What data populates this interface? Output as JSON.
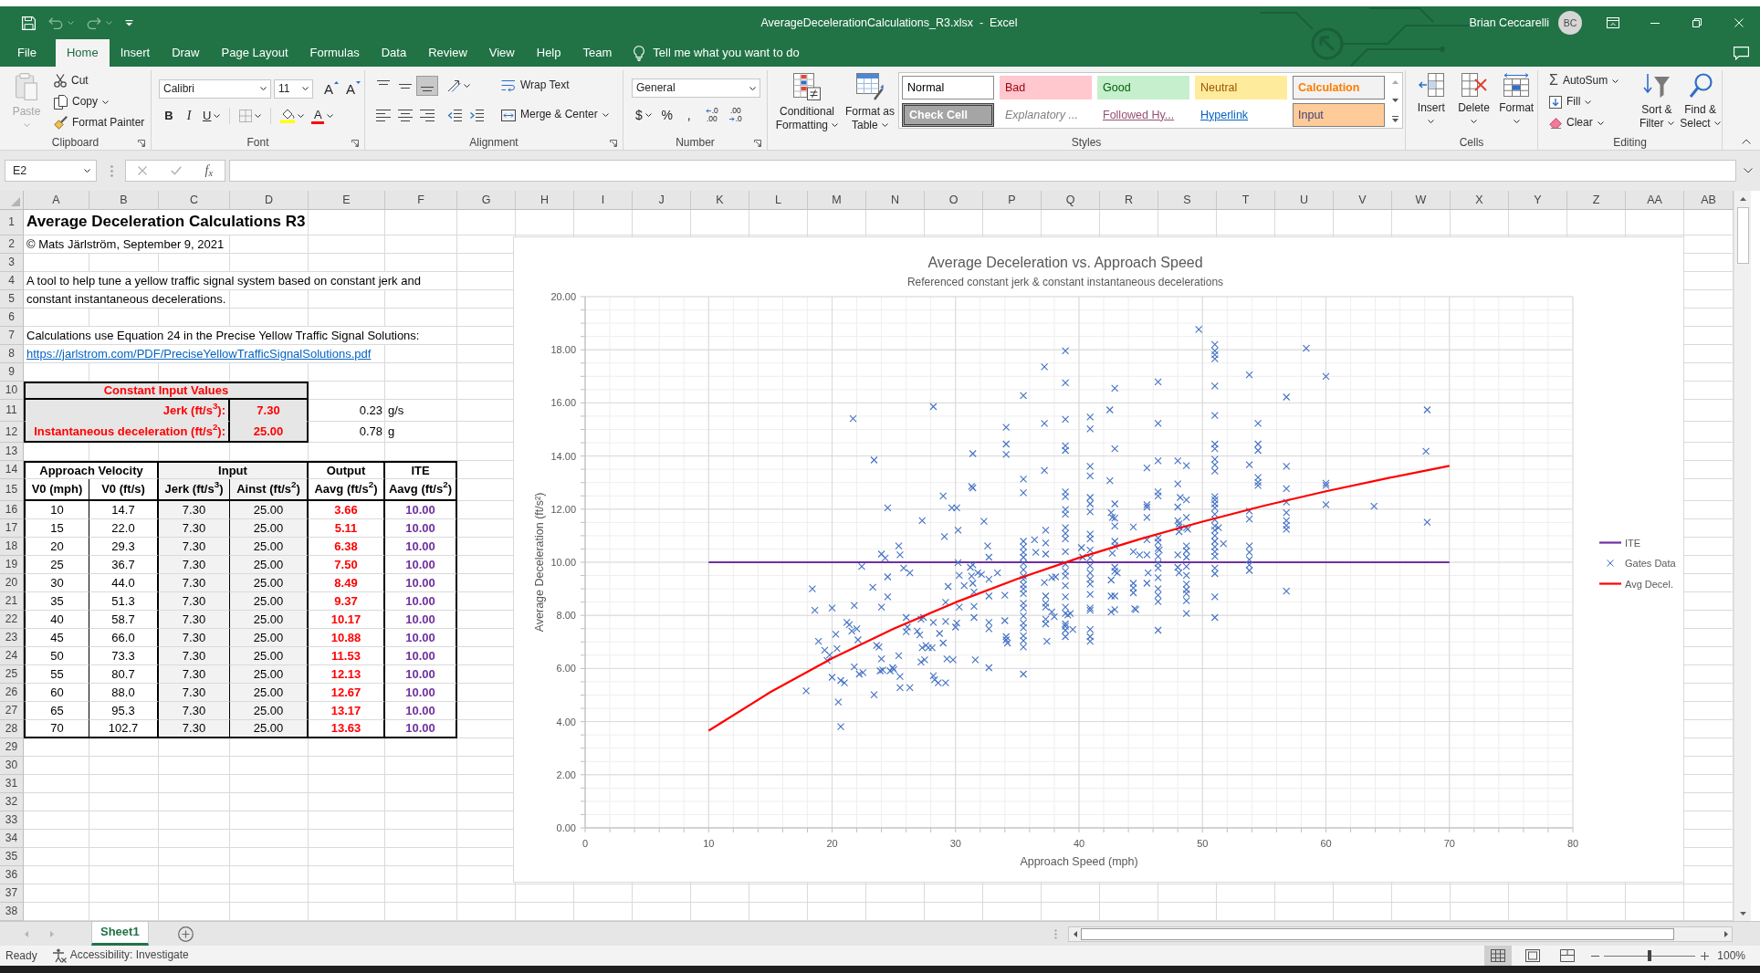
{
  "title_bar": {
    "quick_access": [
      {
        "kind": "save",
        "disabled": false
      },
      {
        "kind": "undo",
        "disabled": true
      },
      {
        "kind": "redo",
        "disabled": true
      },
      {
        "kind": "customize",
        "disabled": false
      }
    ],
    "title": "AverageDecelerationCalculations_R3.xlsx  -  Excel",
    "user": "Brian Ceccarelli",
    "avatar": "BC"
  },
  "tabs": [
    {
      "label": "File",
      "selected": false
    },
    {
      "label": "Home",
      "selected": true
    },
    {
      "label": "Insert",
      "selected": false
    },
    {
      "label": "Draw",
      "selected": false
    },
    {
      "label": "Page Layout",
      "selected": false
    },
    {
      "label": "Formulas",
      "selected": false
    },
    {
      "label": "Data",
      "selected": false
    },
    {
      "label": "Review",
      "selected": false
    },
    {
      "label": "View",
      "selected": false
    },
    {
      "label": "Help",
      "selected": false
    },
    {
      "label": "Team",
      "selected": false
    }
  ],
  "tell_me": {
    "label": "Tell me what you want to do"
  },
  "ribbon": {
    "clipboard": {
      "label": "Clipboard",
      "paste": {
        "label": "Paste",
        "disabled": true
      },
      "cut": "Cut",
      "copy": "Copy",
      "format_painter": "Format Painter"
    },
    "font": {
      "label": "Font",
      "font_name": "Calibri",
      "font_size": "11",
      "grow": "A",
      "shrink": "A",
      "bold": "B",
      "italic": "I",
      "underline": "U",
      "font_color": "A"
    },
    "alignment": {
      "label": "Alignment",
      "vertical": [
        {
          "kind": "top",
          "selected": false
        },
        {
          "kind": "middle",
          "selected": false
        },
        {
          "kind": "bottom",
          "selected": true
        }
      ],
      "horizontal": [
        {
          "kind": "left",
          "selected": false
        },
        {
          "kind": "center",
          "selected": false
        },
        {
          "kind": "right",
          "selected": false
        }
      ],
      "wrap_text": "Wrap Text",
      "merge": "Merge & Center"
    },
    "number": {
      "label": "Number",
      "format": "General",
      "currency": "$",
      "percent": "%",
      "comma": ",",
      "increase_decimal": {
        "upper": ".0",
        "lower": ".00"
      },
      "decrease_decimal": {
        "upper": ".00",
        "lower": ".0"
      }
    },
    "styles": {
      "label": "Styles",
      "conditional_formatting": "Conditional Formatting",
      "format_as_table": "Format as Table",
      "gallery": [
        {
          "label": "Normal",
          "kind": "normal"
        },
        {
          "label": "Bad",
          "kind": "bad"
        },
        {
          "label": "Good",
          "kind": "good"
        },
        {
          "label": "Neutral",
          "kind": "neutral"
        },
        {
          "label": "Calculation",
          "kind": "calculation"
        },
        {
          "label": "Check Cell",
          "kind": "check"
        },
        {
          "label": "Explanatory ...",
          "kind": "explanatory"
        },
        {
          "label": "Followed Hy...",
          "kind": "followed"
        },
        {
          "label": "Hyperlink",
          "kind": "hyperlink"
        },
        {
          "label": "Input",
          "kind": "input"
        }
      ]
    },
    "cells": {
      "label": "Cells",
      "insert": "Insert",
      "delete": "Delete",
      "format": "Format"
    },
    "editing": {
      "label": "Editing",
      "autosum_symbol": "Σ",
      "autosum": "AutoSum",
      "fill": "Fill",
      "clear": "Clear",
      "sort_filter": "Sort & Filter",
      "find_select": "Find & Select"
    }
  },
  "formula_bar": {
    "name_box": "E2",
    "insert_function": "f$_{x}$"
  },
  "sheet": {
    "columns": [
      "A",
      "B",
      "C",
      "D",
      "E",
      "F",
      "G",
      "H",
      "I",
      "J",
      "K",
      "L",
      "M",
      "N",
      "O",
      "P",
      "Q",
      "R",
      "S",
      "T",
      "U",
      "V",
      "W",
      "X",
      "Y",
      "Z",
      "AA",
      "AB"
    ],
    "rows": [
      "1",
      "2",
      "3",
      "4",
      "5",
      "6",
      "7",
      "8",
      "9",
      "10",
      "11",
      "12",
      "13",
      "14",
      "15",
      "16",
      "17",
      "18",
      "19",
      "20",
      "21",
      "22",
      "23",
      "24",
      "25",
      "26",
      "27",
      "28",
      "29",
      "30",
      "31",
      "32",
      "33",
      "34",
      "35",
      "36",
      "37",
      "38"
    ],
    "title": "Average Deceleration Calculations R3",
    "copyright": "© Mats Järlström, September 9, 2021",
    "description": [
      "A tool to help tune a yellow traffic signal system based on constant jerk and",
      "constant instantaneous decelerations."
    ],
    "reference": "Calculations use Equation 24 in the Precise Yellow Traffic Signal Solutions:",
    "link": "https://jarlstrom.com/PDF/PreciseYellowTrafficSignalSolutions.pdf",
    "constants": {
      "heading": "Constant Input Values",
      "rows": [
        {
          "label": "Jerk (ft/s$^{3}$):",
          "value": "7.30",
          "converted": "0.23",
          "unit": "g/s"
        },
        {
          "label": "Instantaneous deceleration (ft/s$^{2}$):",
          "value": "25.00",
          "converted": "0.78",
          "unit": "g"
        }
      ]
    },
    "table": {
      "groups": [
        {
          "label": "Approach Velocity",
          "kind": "velocity",
          "columns": [
            "V0 (mph)",
            "V0 (ft/s)"
          ]
        },
        {
          "label": "Input",
          "kind": "input",
          "columns": [
            "Jerk (ft/s$^{3}$)",
            "Ainst (ft/s$^{2}$)"
          ]
        },
        {
          "label": "Output",
          "kind": "output",
          "columns": [
            "Aavg (ft/s$^{2}$)"
          ]
        },
        {
          "label": "ITE",
          "kind": "reference",
          "columns": [
            "Aavg (ft/s$^{2}$)"
          ]
        }
      ],
      "rows": [
        [
          "10",
          "14.7",
          "7.30",
          "25.00",
          "3.66",
          "10.00"
        ],
        [
          "15",
          "22.0",
          "7.30",
          "25.00",
          "5.11",
          "10.00"
        ],
        [
          "20",
          "29.3",
          "7.30",
          "25.00",
          "6.38",
          "10.00"
        ],
        [
          "25",
          "36.7",
          "7.30",
          "25.00",
          "7.50",
          "10.00"
        ],
        [
          "30",
          "44.0",
          "7.30",
          "25.00",
          "8.49",
          "10.00"
        ],
        [
          "35",
          "51.3",
          "7.30",
          "25.00",
          "9.37",
          "10.00"
        ],
        [
          "40",
          "58.7",
          "7.30",
          "25.00",
          "10.17",
          "10.00"
        ],
        [
          "45",
          "66.0",
          "7.30",
          "25.00",
          "10.88",
          "10.00"
        ],
        [
          "50",
          "73.3",
          "7.30",
          "25.00",
          "11.53",
          "10.00"
        ],
        [
          "55",
          "80.7",
          "7.30",
          "25.00",
          "12.13",
          "10.00"
        ],
        [
          "60",
          "88.0",
          "7.30",
          "25.00",
          "12.67",
          "10.00"
        ],
        [
          "65",
          "95.3",
          "7.30",
          "25.00",
          "13.17",
          "10.00"
        ],
        [
          "70",
          "102.7",
          "7.30",
          "25.00",
          "13.63",
          "10.00"
        ]
      ]
    },
    "chart": {
      "subtitle": "Referenced constant jerk & constant instantaneous decelerations",
      "chart_data": {
        "type": "scatter",
        "title": "Average Deceleration vs. Approach Speed",
        "xlabel": "Approach Speed (mph)",
        "ylabel": "Average Deceleration (ft/s²)",
        "xlim": [
          0,
          80
        ],
        "ylim": [
          0,
          20
        ],
        "xticks": [
          0,
          10,
          20,
          30,
          40,
          50,
          60,
          70,
          80
        ],
        "yticks": [
          {
            "value": 0,
            "label": "0.00"
          },
          {
            "value": 2,
            "label": "2.00"
          },
          {
            "value": 4,
            "label": "4.00"
          },
          {
            "value": 6,
            "label": "6.00"
          },
          {
            "value": 8,
            "label": "8.00"
          },
          {
            "value": 10,
            "label": "10.00"
          },
          {
            "value": 12,
            "label": "12.00"
          },
          {
            "value": 14,
            "label": "14.00"
          },
          {
            "value": 16,
            "label": "16.00"
          },
          {
            "value": 18,
            "label": "18.00"
          },
          {
            "value": 20,
            "label": "20.00"
          }
        ],
        "grid": true,
        "legend": "right",
        "series": [
          {
            "name": "ITE",
            "type": "line",
            "color": "#7030a0",
            "x": [
              10,
              15,
              20,
              25,
              30,
              35,
              40,
              45,
              50,
              55,
              60,
              65,
              70
            ],
            "values": [
              10,
              10,
              10,
              10,
              10,
              10,
              10,
              10,
              10,
              10,
              10,
              10,
              10
            ]
          },
          {
            "name": "Gates Data",
            "type": "scatter",
            "color": "#4472c4",
            "x": [
              17.9,
              18.4,
              18.6,
              18.9,
              19.4,
              19.6,
              19.8,
              20,
              20,
              20.3,
              20.4,
              20.5,
              20.7,
              20.7,
              21,
              21.2,
              21.4,
              21.6,
              21.7,
              21.8,
              21.8,
              22,
              22.1,
              22.2,
              22.4,
              22.5,
              23.3,
              23.4,
              23.4,
              23.6,
              23.8,
              23.9,
              24,
              24,
              24,
              24.1,
              24.3,
              24.5,
              24.5,
              24.5,
              24.7,
              24.9,
              25,
              25.4,
              25.5,
              25.4,
              25.5,
              25.5,
              25.8,
              26,
              26,
              26.1,
              26.3,
              26.3,
              26.9,
              27.1,
              27.3,
              27.2,
              27.2,
              27.3,
              27.4,
              27.5,
              27.6,
              27.8,
              28.1,
              28.2,
              28.2,
              28.2,
              28.3,
              28.6,
              28.7,
              29,
              29,
              29.1,
              29.2,
              29.2,
              29.2,
              29.3,
              29.4,
              29.8,
              29.7,
              30,
              30.1,
              30.1,
              30.2,
              30.2,
              30.3,
              30.3,
              30.7,
              31.2,
              31.3,
              31.3,
              31.4,
              31.4,
              31.4,
              31.4,
              31.5,
              31.5,
              31.5,
              31.6,
              31.8,
              32.1,
              32.3,
              32.6,
              32.7,
              32.7,
              32.7,
              32.7,
              32.7,
              32.7,
              33.4,
              34,
              34,
              34.1,
              34.1,
              34.1,
              34.1,
              34.1,
              34.2,
              35.5,
              35.5,
              35.5,
              35.5,
              35.5,
              35.5,
              35.5,
              35.5,
              35.5,
              35.5,
              35.5,
              35.5,
              35.5,
              35.5,
              35.5,
              35.5,
              35.5,
              35.5,
              35.5,
              35.5,
              35.5,
              35.5,
              35.5,
              36.4,
              36.5,
              37.2,
              37.2,
              37.2,
              37.3,
              37.3,
              37.3,
              37.2,
              37.3,
              37.3,
              37.3,
              37.3,
              37.3,
              37.4,
              37.8,
              37.8,
              38,
              38.1,
              38.9,
              38.9,
              38.9,
              38.9,
              38.9,
              38.9,
              38.9,
              38.9,
              38.9,
              38.9,
              38.9,
              38.9,
              38.9,
              38.9,
              38.9,
              38.9,
              38.9,
              38.9,
              38.9,
              38.9,
              38.9,
              38.9,
              38.9,
              38.9,
              39.1,
              39.3,
              39.5,
              40.2,
              40.3,
              40.9,
              40.9,
              40.9,
              40.9,
              40.9,
              40.9,
              40.9,
              40.9,
              40.9,
              40.9,
              40.9,
              40.9,
              40.9,
              40.9,
              40.9,
              40.9,
              40.9,
              40.9,
              40.9,
              40.9,
              40.9,
              42.5,
              42.5,
              42.6,
              42.6,
              42.6,
              42.6,
              42.7,
              42.7,
              42.9,
              42.9,
              42.9,
              42.9,
              42.9,
              42.9,
              42.9,
              42.9,
              42.9,
              42.9,
              42.9,
              43.1,
              44.4,
              44.4,
              44.4,
              44.4,
              44.4,
              44.5,
              44.6,
              44.9,
              45.5,
              45.5,
              45.5,
              45.5,
              45.5,
              45.5,
              45.5,
              45.6,
              46.4,
              46.4,
              46.4,
              46.4,
              46.4,
              46.4,
              46.4,
              46.4,
              46.4,
              46.4,
              46.4,
              46.4,
              46.4,
              46.4,
              46.4,
              46.4,
              46.5,
              48,
              48,
              48,
              48,
              48.1,
              48.1,
              48.1,
              48,
              48,
              48.1,
              48.2,
              48.7,
              48.7,
              48.7,
              48.7,
              48.7,
              48.7,
              48.7,
              48.7,
              48.7,
              48.7,
              48.7,
              48.7,
              48.7,
              48.7,
              48.8,
              49.7,
              51,
              51,
              51,
              51,
              51,
              51,
              51,
              51,
              51,
              51,
              51,
              51,
              51,
              51,
              51,
              51,
              51,
              51,
              51,
              51,
              51,
              51,
              51,
              51,
              51,
              51,
              51,
              51,
              51.7,
              51.3,
              53.8,
              53.8,
              53.8,
              53.8,
              53.8,
              53.8,
              53.8,
              53.8,
              53.8,
              54.5,
              54.5,
              54.5,
              54.5,
              54.5,
              54.5,
              56.8,
              56.8,
              56.8,
              56.8,
              56.8,
              56.8,
              56.8,
              56.8,
              56.8,
              58.4,
              60,
              60,
              60,
              60,
              63.9,
              68.2,
              68.1,
              68.2
            ],
            "values": [
              5.16,
              9.0,
              8.19,
              7.02,
              6.69,
              6.3,
              6.51,
              8.28,
              5.67,
              7.29,
              6.75,
              4.74,
              3.81,
              5.55,
              5.46,
              7.74,
              7.65,
              7.41,
              15.41,
              6.06,
              8.37,
              7.5,
              7.08,
              5.79,
              9.84,
              5.85,
              9.06,
              13.85,
              5.01,
              6.87,
              6.81,
              5.91,
              10.31,
              6.36,
              8.31,
              5.94,
              10.16,
              12.05,
              9.45,
              8.7,
              5.91,
              6.03,
              5.97,
              10.61,
              10.28,
              6.48,
              5.7,
              5.28,
              9.78,
              7.92,
              7.38,
              7.56,
              5.28,
              9.6,
              7.41,
              7.26,
              11.57,
              7.86,
              6.24,
              6.78,
              7.92,
              6.33,
              6.87,
              6.78,
              6.78,
              15.86,
              7.74,
              5.73,
              5.58,
              5.46,
              7.32,
              12.5,
              6.96,
              10.97,
              8.49,
              5.46,
              7.77,
              6.36,
              9.09,
              6.33,
              12.05,
              7.56,
              12.05,
              7.71,
              9.99,
              11.21,
              9.51,
              8.31,
              9.12,
              9.81,
              12.86,
              9.48,
              14.09,
              12.8,
              9.9,
              9.21,
              8.88,
              8.34,
              7.92,
              6.33,
              9.6,
              9.54,
              11.54,
              10.61,
              10.19,
              9.36,
              8.73,
              7.74,
              7.5,
              6.03,
              9.6,
              8.76,
              7.8,
              15.08,
              14.45,
              14.06,
              7.2,
              7.08,
              6.96,
              16.28,
              13.13,
              12.62,
              10.79,
              10.58,
              10.37,
              10.19,
              9.96,
              9.72,
              9.48,
              9.36,
              9.15,
              9.0,
              8.82,
              8.46,
              8.28,
              7.98,
              7.71,
              7.53,
              7.23,
              7.05,
              6.81,
              5.79,
              10.85,
              10.37,
              17.36,
              15.23,
              13.46,
              11.21,
              10.73,
              10.31,
              9.24,
              8.73,
              8.46,
              8.31,
              7.86,
              7.68,
              7.02,
              9.42,
              8.13,
              7.95,
              9.45,
              17.96,
              16.76,
              15.38,
              14.39,
              14.21,
              12.65,
              12.47,
              11.99,
              11.81,
              11.3,
              11.09,
              10.88,
              10.4,
              9.93,
              9.66,
              9.48,
              9.12,
              8.7,
              8.31,
              8.07,
              7.68,
              7.44,
              7.2,
              7.59,
              8.01,
              8.07,
              7.47,
              10.55,
              10.19,
              15.47,
              15.02,
              13.61,
              13.25,
              12.44,
              12.2,
              11.9,
              11.06,
              10.88,
              10.46,
              10.16,
              9.87,
              9.6,
              9.36,
              9.18,
              8.79,
              8.28,
              8.19,
              7.47,
              7.2,
              7.02,
              15.74,
              13.07,
              11.87,
              9.33,
              8.73,
              8.13,
              11.69,
              10.34,
              16.55,
              14.27,
              12.2,
              11.66,
              11.36,
              10.79,
              10.61,
              9.81,
              9.66,
              8.73,
              8.22,
              9.6,
              10.4,
              11.33,
              9.21,
              9.03,
              8.85,
              8.25,
              8.22,
              10.28,
              13.55,
              12.17,
              12.08,
              11.69,
              10.85,
              10.28,
              9.21,
              9.6,
              16.79,
              15.23,
              13.82,
              12.65,
              12.5,
              10.91,
              10.76,
              10.52,
              10.22,
              9.96,
              9.78,
              9.42,
              9.0,
              8.76,
              8.52,
              7.44,
              10.46,
              13.82,
              12.95,
              12.08,
              11.57,
              11.45,
              11.33,
              11.15,
              10.28,
              9.81,
              9.6,
              12.44,
              13.64,
              12.35,
              11.69,
              11.3,
              10.61,
              10.43,
              10.19,
              9.84,
              9.51,
              9.18,
              8.97,
              8.82,
              8.55,
              8.07,
              11.24,
              18.77,
              18.2,
              17.96,
              17.81,
              17.66,
              16.64,
              15.53,
              14.45,
              14.27,
              13.88,
              13.67,
              13.43,
              12.47,
              12.35,
              12.2,
              12.05,
              11.81,
              11.6,
              11.36,
              11.21,
              11.0,
              10.79,
              10.58,
              10.4,
              10.22,
              9.78,
              9.57,
              8.7,
              7.92,
              10.7,
              11.3,
              17.06,
              13.67,
              11.93,
              11.63,
              10.61,
              10.37,
              10.1,
              9.9,
              9.69,
              15.23,
              14.45,
              14.21,
              13.19,
              13.01,
              12.89,
              16.22,
              13.61,
              12.77,
              12.26,
              11.87,
              11.57,
              11.39,
              11.24,
              8.91,
              18.05,
              17.0,
              12.98,
              12.89,
              12.17,
              12.11,
              15.74,
              14.18,
              11.51
            ]
          },
          {
            "name": "Avg Decel.",
            "type": "line",
            "color": "#ff0000",
            "x": [
              10,
              15,
              20,
              25,
              30,
              35,
              40,
              45,
              50,
              55,
              60,
              65,
              70
            ],
            "values": [
              3.66,
              5.11,
              6.38,
              7.5,
              8.49,
              9.37,
              10.17,
              10.88,
              11.53,
              12.13,
              12.67,
              13.17,
              13.63
            ]
          }
        ]
      }
    }
  },
  "sheet_tabs": {
    "navigation": [
      {
        "kind": "previous",
        "disabled": true
      },
      {
        "kind": "next",
        "disabled": true
      }
    ],
    "tabs": [
      {
        "label": "Sheet1",
        "selected": true
      }
    ]
  },
  "status_bar": {
    "status": "Ready",
    "accessibility": "Accessibility: Investigate",
    "views": [
      {
        "kind": "normal",
        "selected": true
      },
      {
        "kind": "page_layout",
        "selected": false
      },
      {
        "kind": "page_break",
        "selected": false
      }
    ],
    "zoom_slider": {
      "level": 0.5
    },
    "zoom": "100%"
  }
}
